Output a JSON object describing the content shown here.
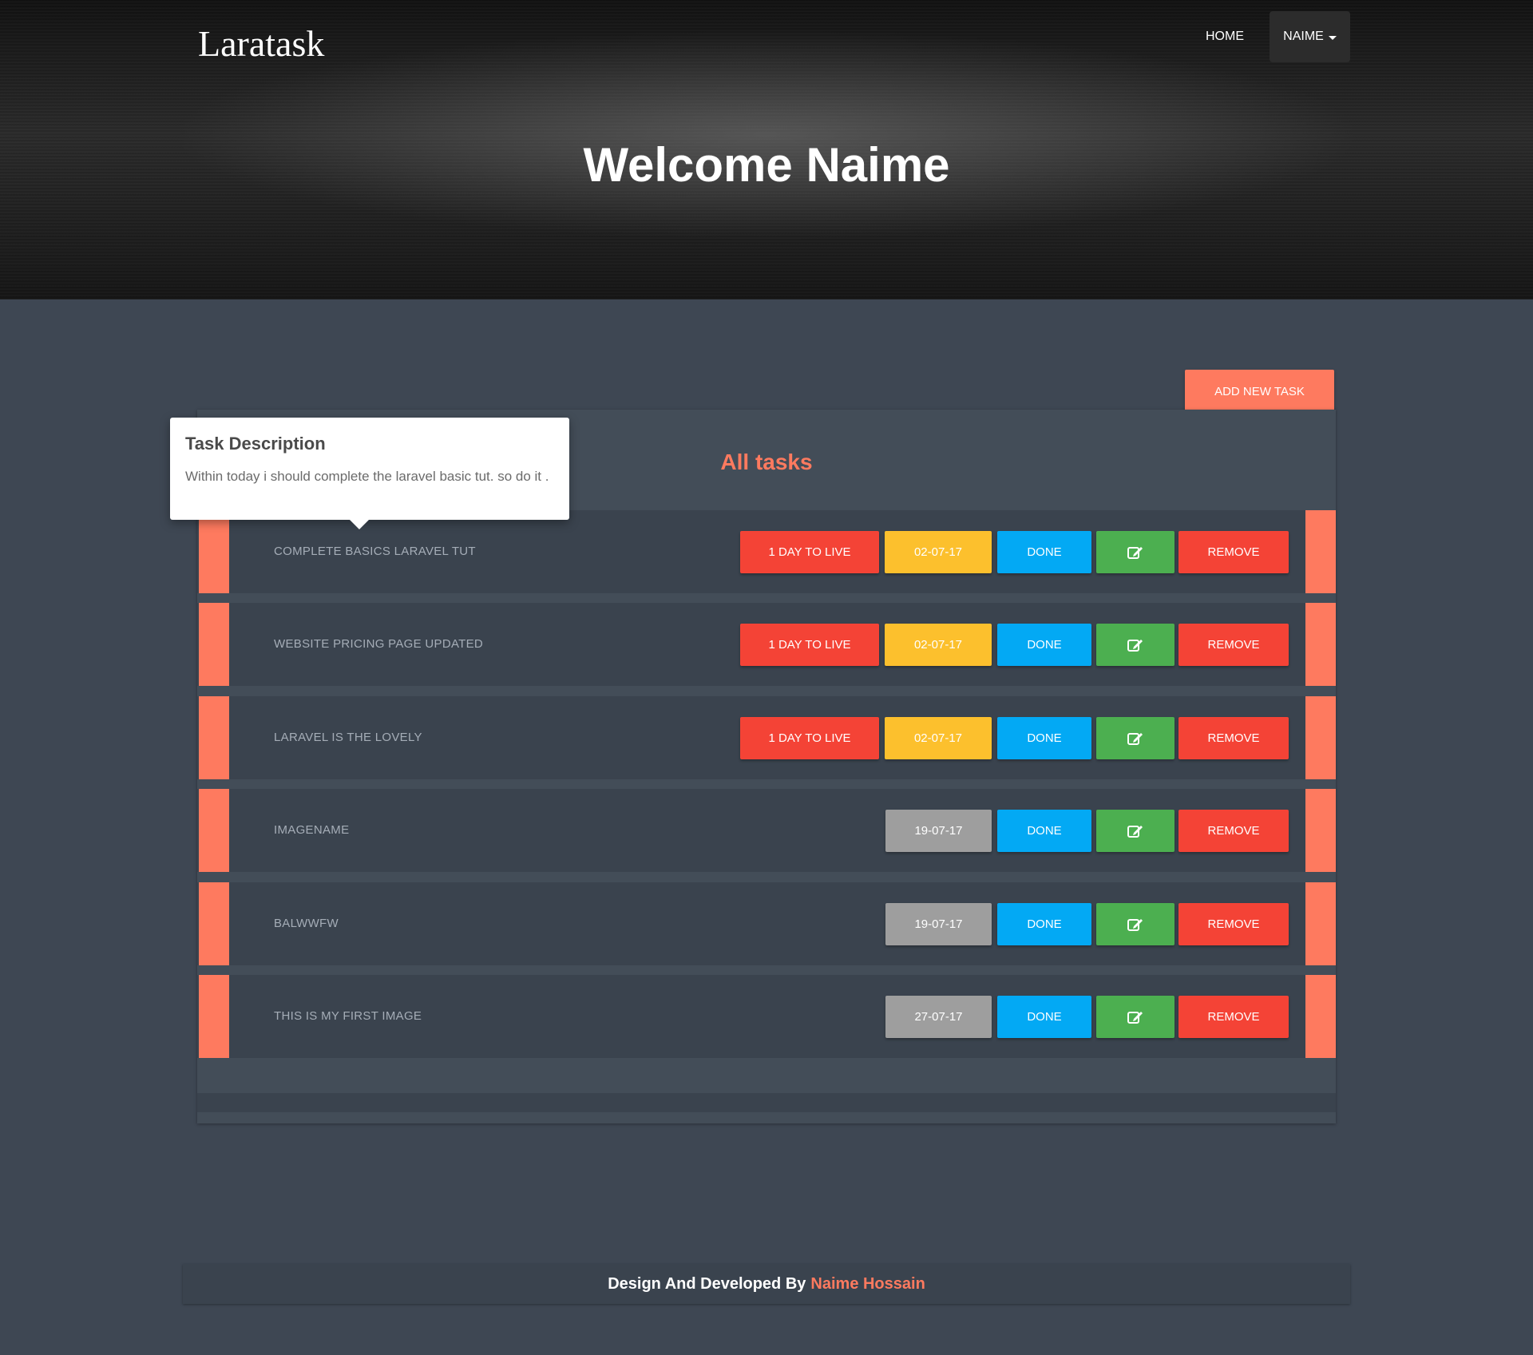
{
  "brand": "Laratask",
  "nav": {
    "home": "HOME",
    "user": "NAIME"
  },
  "hero": {
    "welcome": "Welcome Naime"
  },
  "add_task_label": "ADD NEW TASK",
  "panel_title": "All tasks",
  "popover": {
    "title": "Task Description",
    "body": "Within today i should complete the laravel basic tut. so do it ."
  },
  "tasks": [
    {
      "name": "COMPLETE BASICS LARAVEL TUT",
      "live": "1 DAY TO LIVE",
      "date": "02-07-17",
      "done": "DONE",
      "remove": "REMOVE"
    },
    {
      "name": "WEBSITE PRICING PAGE UPDATED",
      "live": "1 DAY TO LIVE",
      "date": "02-07-17",
      "done": "DONE",
      "remove": "REMOVE"
    },
    {
      "name": "LARAVEL IS THE LOVELY",
      "live": "1 DAY TO LIVE",
      "date": "02-07-17",
      "done": "DONE",
      "remove": "REMOVE"
    },
    {
      "name": "IMAGENAME",
      "date": "19-07-17",
      "done": "DONE",
      "remove": "REMOVE"
    },
    {
      "name": "BALWWFW",
      "date": "19-07-17",
      "done": "DONE",
      "remove": "REMOVE"
    },
    {
      "name": "THIS IS MY FIRST IMAGE",
      "date": "27-07-17",
      "done": "DONE",
      "remove": "REMOVE"
    }
  ],
  "footer": {
    "prefix": "Design And Developed By",
    "author": "Naime Hossain"
  },
  "colors": {
    "accent": "#fe7a5f",
    "danger": "#f44336",
    "warning": "#fcc02d",
    "info": "#03a9f4",
    "success": "#4caf50",
    "muted": "#9e9e9e"
  },
  "icons": {
    "edit": "edit-icon",
    "dropdown": "caret-down-icon"
  }
}
